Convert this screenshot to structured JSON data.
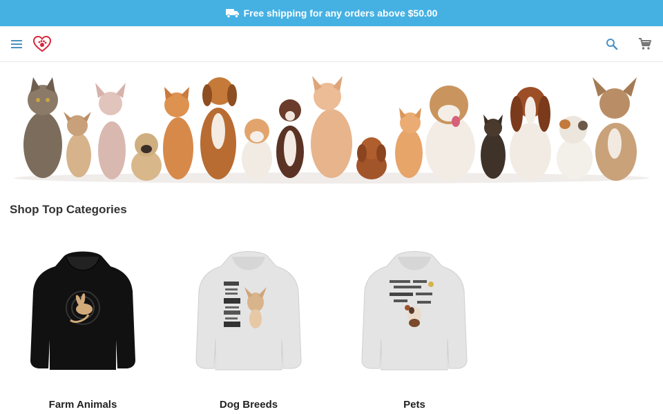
{
  "promo": {
    "text": "Free shipping for any orders above $50.00",
    "icon": "truck-icon",
    "background": "#45b1e3"
  },
  "header": {
    "menu_icon": "menu-icon",
    "logo_icon": "heart-paw-logo",
    "search_icon": "search-icon",
    "cart_icon": "cart-icon"
  },
  "section": {
    "title": "Shop Top Categories"
  },
  "categories": [
    {
      "label": "Farm Animals",
      "hoodie_color": "#111111"
    },
    {
      "label": "Dog Breeds",
      "hoodie_color": "#e4e4e4"
    },
    {
      "label": "Pets",
      "hoodie_color": "#e4e4e4"
    }
  ]
}
